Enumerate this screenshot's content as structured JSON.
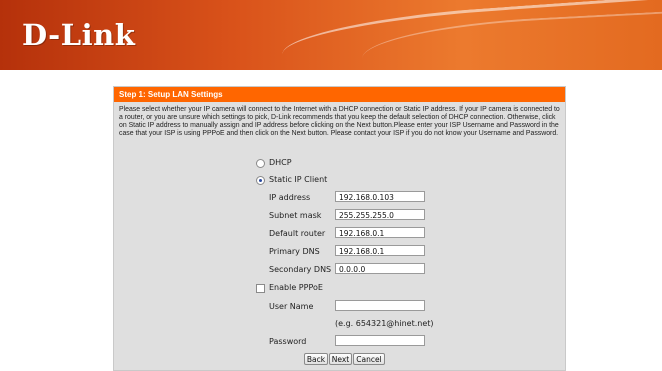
{
  "brand": {
    "logo_text": "D-Link"
  },
  "colors": {
    "header_orange": "#e36a20",
    "title_bar": "#ff6600",
    "panel_bg": "#dfdfdf"
  },
  "panel": {
    "title": "Step 1: Setup LAN Settings",
    "description": "Please select whether your IP camera will connect to the Internet with a DHCP connection or Static IP address. If your IP camera is connected to a router, or you are unsure which settings to pick, D-Link recommends that you keep the default selection of DHCP connection. Otherwise, click on Static IP address to manually assign and IP address before clicking on the Next button.Please enter your ISP Username and Password in the case that your ISP is using PPPoE and then click on the Next button. Please contact your ISP if you do not know your Username and Password."
  },
  "options": {
    "dhcp_label": "DHCP",
    "static_label": "Static IP Client",
    "selected": "static"
  },
  "static_fields": {
    "ip_label": "IP address",
    "ip_value": "192.168.0.103",
    "mask_label": "Subnet mask",
    "mask_value": "255.255.255.0",
    "router_label": "Default router",
    "router_value": "192.168.0.1",
    "dns1_label": "Primary DNS",
    "dns1_value": "192.168.0.1",
    "dns2_label": "Secondary DNS",
    "dns2_value": "0.0.0.0"
  },
  "pppoe": {
    "enable_label": "Enable PPPoE",
    "checked": false,
    "username_label": "User Name",
    "username_value": "",
    "hint": "(e.g. 654321@hinet.net)",
    "password_label": "Password",
    "password_value": ""
  },
  "buttons": {
    "back": "Back",
    "next": "Next",
    "cancel": "Cancel"
  }
}
